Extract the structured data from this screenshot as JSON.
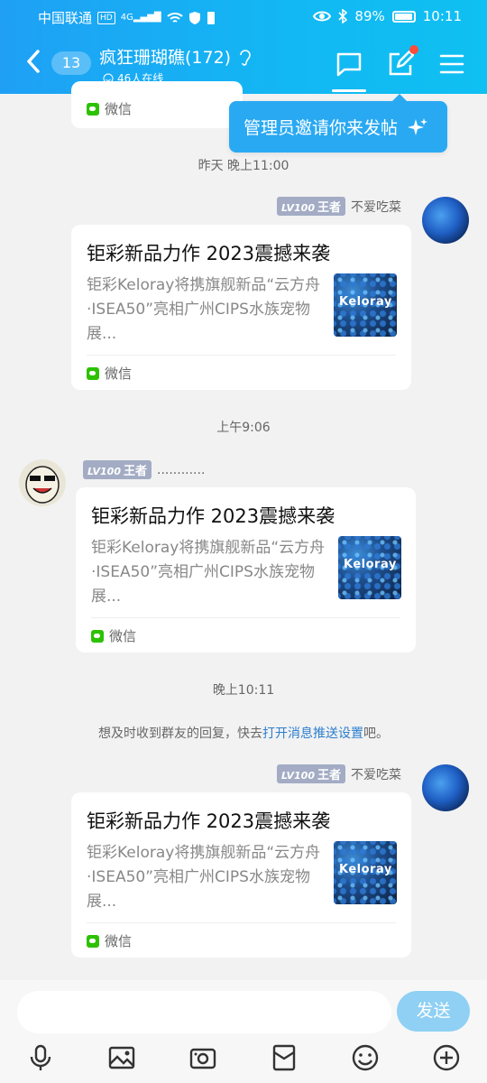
{
  "status_bar": {
    "carrier": "中国联通",
    "network_tag": "HD",
    "signal_type": "4G",
    "battery": "89%",
    "time": "10:11"
  },
  "header": {
    "unread_count": "13",
    "group_name": "疯狂珊瑚礁(172)",
    "online": "46人在线"
  },
  "tooltip": "管理员邀请你来发帖",
  "messages": [
    {
      "kind": "partial_card",
      "source": "微信"
    },
    {
      "kind": "time",
      "text": "昨天 晚上11:00"
    },
    {
      "kind": "card",
      "sender": "不爱吃菜",
      "level": "LV100",
      "rank": "王者",
      "title": "钜彩新品力作 2023震撼来袭",
      "desc": "钜彩Keloray将携旗舰新品“云方舟·ISEA50”亮相广州CIPS水族宠物展...",
      "thumb": "Keloray",
      "source": "微信"
    },
    {
      "kind": "time",
      "text": "上午9:06"
    },
    {
      "kind": "card",
      "sender": "............",
      "level": "LV100",
      "rank": "王者",
      "title": "钜彩新品力作 2023震撼来袭",
      "desc": "钜彩Keloray将携旗舰新品“云方舟·ISEA50”亮相广州CIPS水族宠物展...",
      "thumb": "Keloray",
      "source": "微信"
    },
    {
      "kind": "time",
      "text": "晚上10:11"
    },
    {
      "kind": "notice",
      "text": "想及时收到群友的回复，快去",
      "link": "打开消息推送设置",
      "suffix": "吧。"
    },
    {
      "kind": "card",
      "sender": "不爱吃菜",
      "level": "LV100",
      "rank": "王者",
      "title": "钜彩新品力作 2023震撼来袭",
      "desc": "钜彩Keloray将携旗舰新品“云方舟·ISEA50”亮相广州CIPS水族宠物展...",
      "thumb": "Keloray",
      "source": "微信"
    }
  ],
  "composer": {
    "send_label": "发送"
  }
}
